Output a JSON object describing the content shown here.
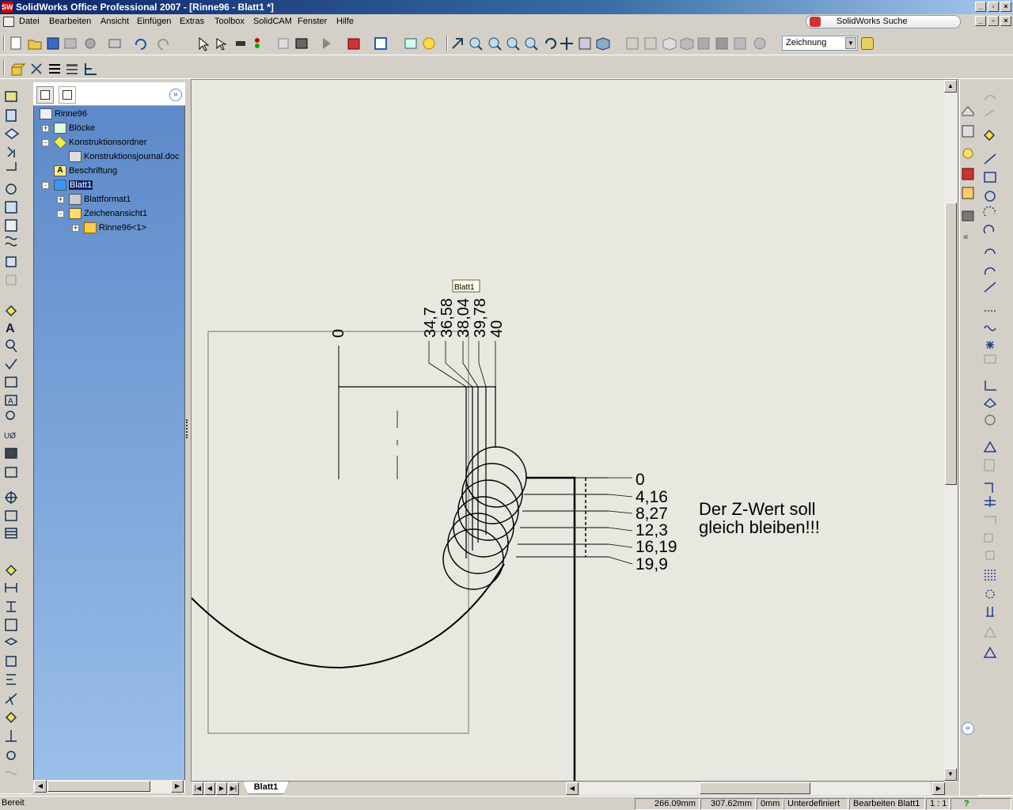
{
  "window": {
    "title": "SolidWorks Office Professional 2007 - [Rinne96 - Blatt1 *]",
    "app_icon_label": "SW"
  },
  "menu": {
    "items": [
      "Datei",
      "Bearbeiten",
      "Ansicht",
      "Einfügen",
      "Extras",
      "Toolbox",
      "SolidCAM",
      "Fenster",
      "Hilfe"
    ],
    "search_label": "SolidWorks Suche"
  },
  "toolbar": {
    "config_select": "Zeichnung"
  },
  "feature_manager": {
    "items": [
      {
        "label": "Rinne96"
      },
      {
        "label": "Blöcke"
      },
      {
        "label": "Konstruktionsordner"
      },
      {
        "label": "Konstruktionsjournal.doc"
      },
      {
        "label": "Beschriftung"
      },
      {
        "label": "Blatt1"
      },
      {
        "label": "Blattformat1"
      },
      {
        "label": "Zeichenansicht1"
      },
      {
        "label": "Rinne96<1>"
      }
    ]
  },
  "drawing": {
    "tooltip": "Blatt1",
    "top_dims": [
      "34,7",
      "36,58",
      "38,04",
      "39,78",
      "40"
    ],
    "zero_top": "0",
    "right_dims": [
      "0",
      "4,16",
      "8,27",
      "12,3",
      "16,19",
      "19,9"
    ],
    "note_line1": "Der Z-Wert soll",
    "note_line2": "gleich bleiben!!!"
  },
  "sheet_tab": "Blatt1",
  "status": {
    "left": "Bereit",
    "x": "266.09mm",
    "y": "307.62mm",
    "z": "0mm",
    "state": "Unterdefiniert",
    "mode": "Bearbeiten Blatt1",
    "scale": "1 : 1",
    "help": "?"
  }
}
